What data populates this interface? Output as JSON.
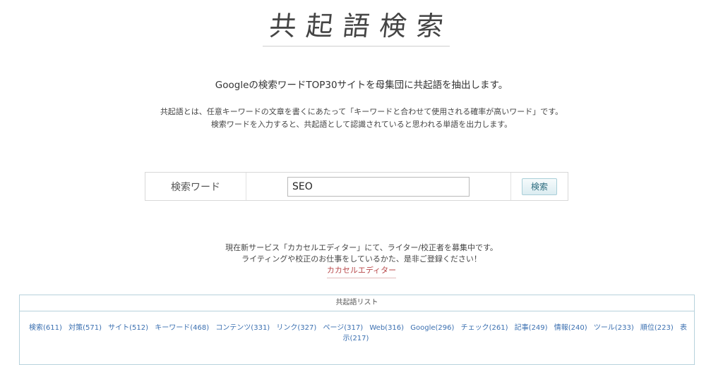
{
  "logo": {
    "text": "共起語検索"
  },
  "headline": "Googleの検索ワードTOP30サイトを母集団に共起語を抽出します。",
  "description": {
    "line1": "共起語とは、任意キーワードの文章を書くにあたって「キーワードと合わせて使用される確率が高いワード」です。",
    "line2": "検索ワードを入力すると、共起語として認識されていると思われる単語を出力します。"
  },
  "search": {
    "label": "検索ワード",
    "value": "SEO",
    "button_label": "検索"
  },
  "promo": {
    "line1": "現在新サービス「カカセルエディター」にて、ライター/校正者を募集中です。",
    "line2": "ライティングや校正のお仕事をしているかた、是非ご登録ください！",
    "link_label": "カカセルエディター"
  },
  "cooccurrence": {
    "header": "共起語リスト",
    "items": [
      "検索(611)",
      "対策(571)",
      "サイト(512)",
      "キーワード(468)",
      "コンテンツ(331)",
      "リンク(327)",
      "ページ(317)",
      "Web(316)",
      "Google(296)",
      "チェック(261)",
      "記事(249)",
      "情報(240)",
      "ツール(233)",
      "順位(223)",
      "表示(217)"
    ]
  },
  "colors": {
    "link": "#3a6fb0",
    "promo_link": "#b8484a",
    "panel_border": "#b7d2dc",
    "button_text": "#2f6e80"
  }
}
